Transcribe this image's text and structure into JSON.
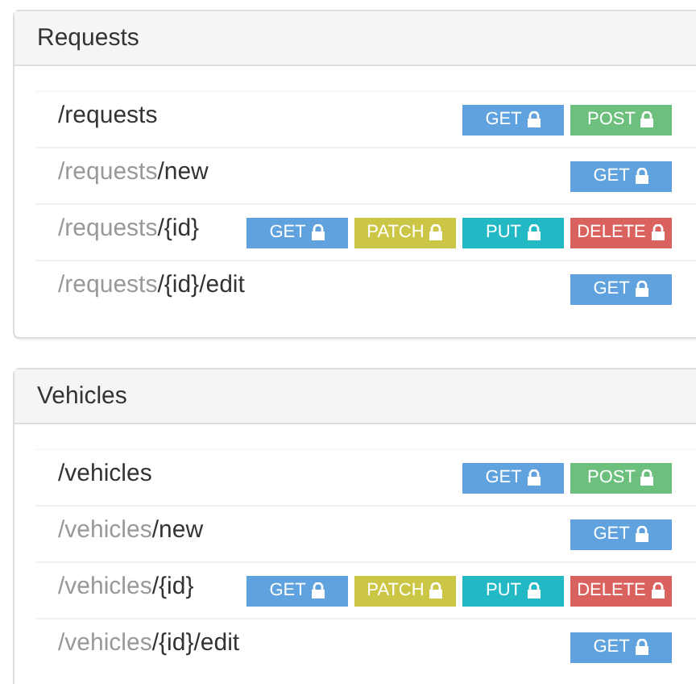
{
  "panels": [
    {
      "title": "Requests",
      "routes": [
        {
          "path": "/requests",
          "methods": [
            {
              "kind": "get",
              "label": "GET"
            },
            {
              "kind": "post",
              "label": "POST"
            }
          ]
        },
        {
          "prefix": "/requests",
          "path": "/new",
          "methods": [
            {
              "kind": "get",
              "label": "GET"
            }
          ]
        },
        {
          "prefix": "/requests",
          "path": "/{id}",
          "methods": [
            {
              "kind": "get",
              "label": "GET"
            },
            {
              "kind": "patch",
              "label": "PATCH"
            },
            {
              "kind": "put",
              "label": "PUT"
            },
            {
              "kind": "delete",
              "label": "DELETE"
            }
          ]
        },
        {
          "prefix": "/requests",
          "path": "/{id}/edit",
          "methods": [
            {
              "kind": "get",
              "label": "GET"
            }
          ]
        }
      ]
    },
    {
      "title": "Vehicles",
      "routes": [
        {
          "path": "/vehicles",
          "methods": [
            {
              "kind": "get",
              "label": "GET"
            },
            {
              "kind": "post",
              "label": "POST"
            }
          ]
        },
        {
          "prefix": "/vehicles",
          "path": "/new",
          "methods": [
            {
              "kind": "get",
              "label": "GET"
            }
          ]
        },
        {
          "prefix": "/vehicles",
          "path": "/{id}",
          "methods": [
            {
              "kind": "get",
              "label": "GET"
            },
            {
              "kind": "patch",
              "label": "PATCH"
            },
            {
              "kind": "put",
              "label": "PUT"
            },
            {
              "kind": "delete",
              "label": "DELETE"
            }
          ]
        },
        {
          "prefix": "/vehicles",
          "path": "/{id}/edit",
          "methods": [
            {
              "kind": "get",
              "label": "GET"
            }
          ]
        }
      ]
    }
  ]
}
